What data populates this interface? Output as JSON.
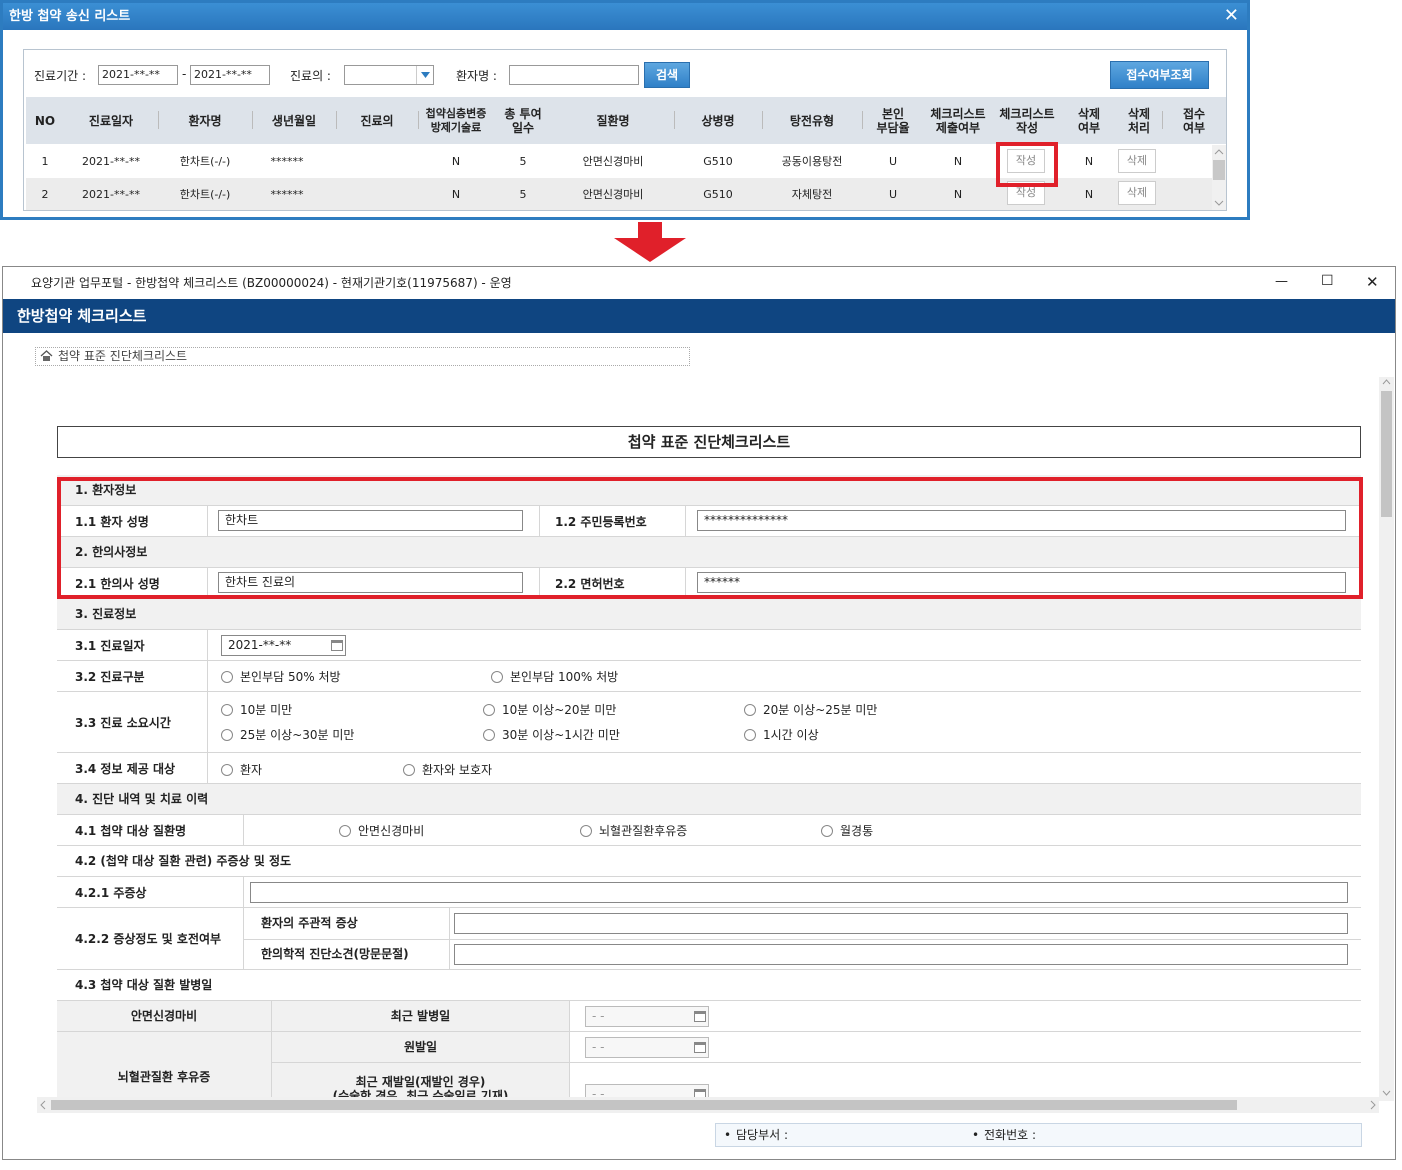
{
  "top_dialog": {
    "title": "한방 첩약 송신 리스트",
    "close": "✕",
    "search": {
      "period_label": "진료기간 :",
      "date_from": "2021-**-**",
      "dash": "-",
      "date_to": "2021-**-**",
      "doctor_label": "진료의 :",
      "doctor_value": "",
      "patient_label": "환자명 :",
      "patient_value": "",
      "search_button": "검색",
      "receipt_button": "접수여부조회"
    },
    "columns": [
      "NO",
      "진료일자",
      "환자명",
      "생년월일",
      "진료의",
      "첩약심층변증\n방제기술료",
      "총 투여\n일수",
      "질환명",
      "상병명",
      "탕전유형",
      "본인\n부담율",
      "체크리스트\n제출여부",
      "체크리스트\n작성",
      "삭제\n여부",
      "삭제\n처리",
      "접수\n여부"
    ],
    "rows": [
      {
        "no": "1",
        "date": "2021-**-**",
        "patient": "한차트(-/-)",
        "birth": "******",
        "doctor": "",
        "fee": "N",
        "days": "5",
        "disease": "안면신경마비",
        "code": "G510",
        "decoction": "공동이용탕전",
        "ratio": "U",
        "submitted": "N",
        "write": "작성",
        "deleted": "N",
        "delete": "삭제",
        "received": ""
      },
      {
        "no": "2",
        "date": "2021-**-**",
        "patient": "한차트(-/-)",
        "birth": "******",
        "doctor": "",
        "fee": "N",
        "days": "5",
        "disease": "안면신경마비",
        "code": "G510",
        "decoction": "자체탕전",
        "ratio": "U",
        "submitted": "N",
        "write": "작성",
        "deleted": "N",
        "delete": "삭제",
        "received": ""
      }
    ]
  },
  "window": {
    "title": "요양기관 업무포털 - 한방첩약 체크리스트 (BZ00000024) - 현재기관기호(11975687) - 운영",
    "minimize": "—",
    "maximize": "☐",
    "close": "✕",
    "header": "한방첩약 체크리스트",
    "breadcrumb": "첩약 표준 진단체크리스트",
    "doc_title": "첩약 표준 진단체크리스트"
  },
  "form": {
    "s1": "1. 환자정보",
    "l11": "1.1 환자 성명",
    "v11": "한차트",
    "l12": "1.2 주민등록번호",
    "v12": "**************",
    "s2": "2. 한의사정보",
    "l21": "2.1 한의사 성명",
    "v21": "한차트 진료의",
    "l22": "2.2 면허번호",
    "v22": "******",
    "s3": "3. 진료정보",
    "l31": "3.1 진료일자",
    "v31": "2021-**-**",
    "l32": "3.2 진료구분",
    "o32": [
      "본인부담 50% 처방",
      "본인부담 100% 처방"
    ],
    "l33": "3.3 진료 소요시간",
    "o33": [
      "10분 미만",
      "10분 이상~20분 미만",
      "20분 이상~25분 미만",
      "25분 이상~30분 미만",
      "30분 이상~1시간 미만",
      "1시간 이상"
    ],
    "l34": "3.4 정보 제공 대상",
    "o34": [
      "환자",
      "환자와 보호자"
    ],
    "s4": "4. 진단 내역 및 치료 이력",
    "l41": "4.1 첩약 대상 질환명",
    "o41": [
      "안면신경마비",
      "뇌혈관질환후유증",
      "월경통"
    ],
    "l42": "4.2 (첩약 대상 질환 관련) 주증상 및 정도",
    "l421": "4.2.1 주증상",
    "l422": "4.2.2 증상정도 및 호전여부",
    "l422a": "환자의 주관적 증상",
    "l422b": "한의학적 진단소견(망문문절)",
    "l43": "4.3 첩약 대상 질환 발병일",
    "d1": "안면신경마비",
    "d1a": "최근 발병일",
    "d2": "뇌혈관질환 후유증",
    "d2a": "원발일",
    "d2b": "최근 재발일(재발인 경우)",
    "d2c": "(수술한 경우, 최근 수술일로 기재)",
    "date_empty": "- -"
  },
  "footer": {
    "dept": "담당부서 :",
    "phone": "전화번호 :"
  },
  "colors": {
    "accent": "#2d7cc0",
    "header": "#0f4581",
    "highlight": "#e0202a"
  }
}
